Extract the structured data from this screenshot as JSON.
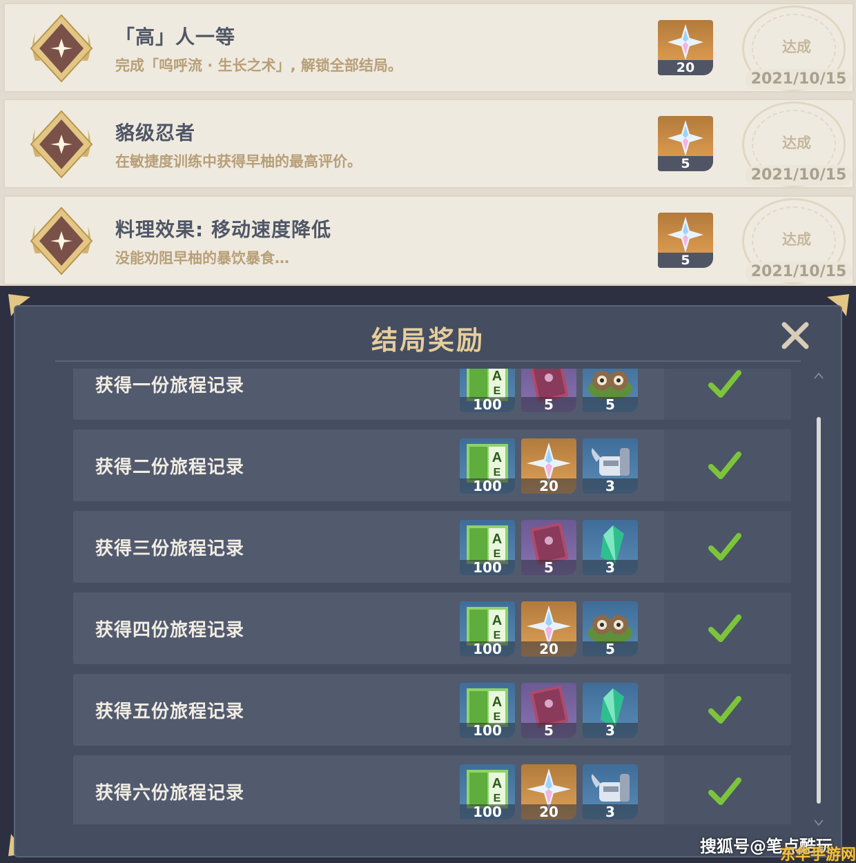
{
  "achievements": [
    {
      "title": "「高」人一等",
      "desc": "完成「呜呼流 · 生长之术」, 解锁全部结局。",
      "reward_count": "20",
      "status": "达成",
      "date": "2021/10/15"
    },
    {
      "title": "貉级忍者",
      "desc": "在敏捷度训练中获得早柚的最高评价。",
      "reward_count": "5",
      "status": "达成",
      "date": "2021/10/15"
    },
    {
      "title": "料理效果: 移动速度降低",
      "desc": "没能劝阻早柚的暴饮暴食…",
      "reward_count": "5",
      "status": "达成",
      "date": "2021/10/15"
    }
  ],
  "dialog": {
    "title": "结局奖励",
    "rows": [
      {
        "label": "获得一份旅程记录",
        "items": [
          {
            "icon": "exp-book-icon",
            "count": "100"
          },
          {
            "icon": "recipe-book-icon",
            "count": "5"
          },
          {
            "icon": "tanuki-food-icon",
            "count": "5"
          }
        ]
      },
      {
        "label": "获得二份旅程记录",
        "items": [
          {
            "icon": "exp-book-icon",
            "count": "100"
          },
          {
            "icon": "primogem-icon",
            "count": "20"
          },
          {
            "icon": "watering-can-icon",
            "count": "3"
          }
        ]
      },
      {
        "label": "获得三份旅程记录",
        "items": [
          {
            "icon": "exp-book-icon",
            "count": "100"
          },
          {
            "icon": "recipe-book-icon",
            "count": "5"
          },
          {
            "icon": "crystal-icon",
            "count": "3"
          }
        ]
      },
      {
        "label": "获得四份旅程记录",
        "items": [
          {
            "icon": "exp-book-icon",
            "count": "100"
          },
          {
            "icon": "primogem-icon",
            "count": "20"
          },
          {
            "icon": "tanuki-food-icon",
            "count": "5"
          }
        ]
      },
      {
        "label": "获得五份旅程记录",
        "items": [
          {
            "icon": "exp-book-icon",
            "count": "100"
          },
          {
            "icon": "recipe-book-icon",
            "count": "5"
          },
          {
            "icon": "crystal-icon",
            "count": "3"
          }
        ]
      },
      {
        "label": "获得六份旅程记录",
        "items": [
          {
            "icon": "exp-book-icon",
            "count": "100"
          },
          {
            "icon": "primogem-icon",
            "count": "20"
          },
          {
            "icon": "watering-can-icon",
            "count": "3"
          }
        ]
      }
    ]
  },
  "watermark": {
    "text": "搜狐号@笔点酷玩",
    "logo": "东华手游网"
  },
  "colors": {
    "accent_gold": "#e6cd9a",
    "check_green": "#7cc53a",
    "primogem_bg": "#d4944a"
  }
}
